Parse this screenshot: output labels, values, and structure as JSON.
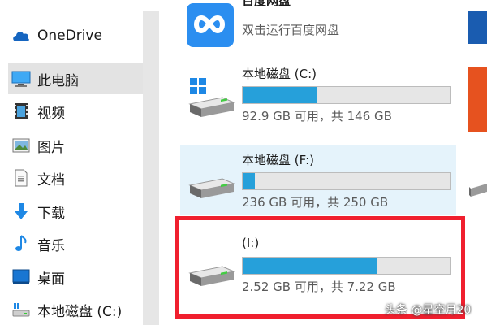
{
  "nav": {
    "items": [
      {
        "label": "OneDrive",
        "icon": "cloud-icon"
      },
      {
        "label": "此电脑",
        "icon": "computer-icon"
      },
      {
        "label": "视频",
        "icon": "video-icon"
      },
      {
        "label": "图片",
        "icon": "picture-icon"
      },
      {
        "label": "文档",
        "icon": "document-icon"
      },
      {
        "label": "下载",
        "icon": "download-arrow-icon"
      },
      {
        "label": "音乐",
        "icon": "music-note-icon"
      },
      {
        "label": "桌面",
        "icon": "desktop-icon"
      },
      {
        "label": "本地磁盘 (C:)",
        "icon": "drive-icon"
      }
    ],
    "selected": "此电脑"
  },
  "content": {
    "app": {
      "title_partial": "百度网盘",
      "subtitle": "双击运行百度网盘",
      "icon": "baidu-netdisk-icon"
    },
    "drives": [
      {
        "name": "本地磁盘 (C:)",
        "info": "92.9 GB 可用，共 146 GB",
        "used_fraction": 0.36,
        "icon": "windows-drive-icon"
      },
      {
        "name": "本地磁盘 (F:)",
        "info": "236 GB 可用，共 250 GB",
        "used_fraction": 0.06,
        "icon": "hdd-icon"
      },
      {
        "name": "(I:)",
        "info": "2.52 GB 可用，共 7.22 GB",
        "used_fraction": 0.65,
        "icon": "hdd-icon"
      }
    ]
  },
  "colors": {
    "bar_fill": "#26a0da",
    "bar_track": "#e6e6e6",
    "highlight_box": "#f01f2e",
    "hover_row": "#e5f3fb"
  },
  "watermark": "头条 @星空月20"
}
